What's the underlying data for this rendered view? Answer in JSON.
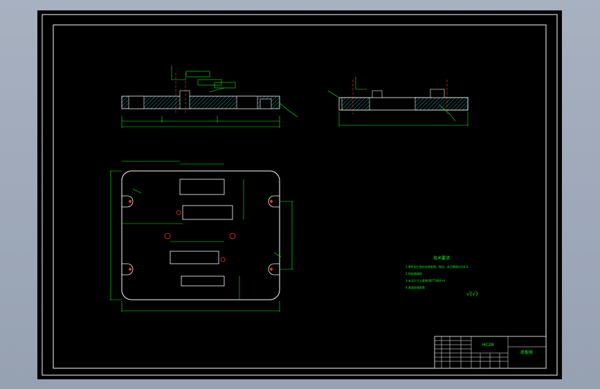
{
  "colors": {
    "background": "#000000",
    "border": "#ffffff",
    "geometry": "#ffffff",
    "dimension": "#00ff00",
    "hatch": "#1aa0a0",
    "hole_red": "#ff3030",
    "notes": "#00ff00"
  },
  "title_block": {
    "drawing_no": "HC2B",
    "part_name": "底板座"
  },
  "notes": {
    "heading": "技术要求",
    "lines": [
      "1.零件加工前应去除毛刺、锐边，未注倒角均为0.5",
      "2.热处理调质",
      "3.未注尺寸公差按GB/T1804-m",
      "4.表面处理发黑"
    ]
  },
  "roughness_symbol": "√(√)"
}
